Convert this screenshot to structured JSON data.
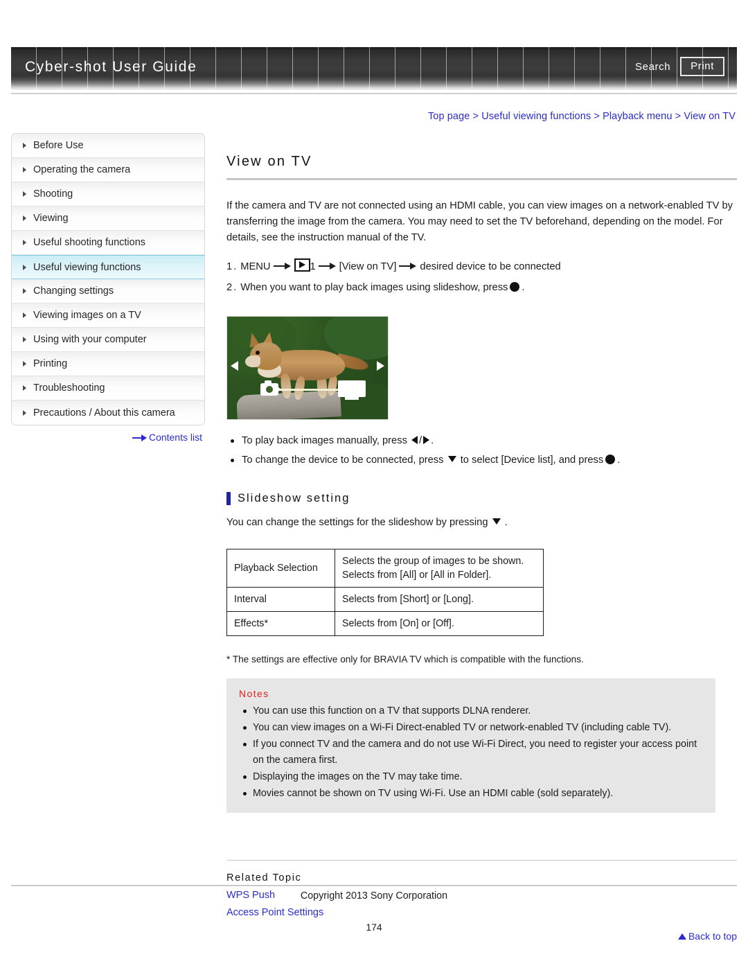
{
  "header": {
    "title": "Cyber-shot User Guide",
    "search_label": "Search",
    "print_label": "Print"
  },
  "breadcrumb": {
    "separator": ">",
    "items": [
      "Top page",
      "Useful viewing functions",
      "Playback menu",
      "View on TV"
    ]
  },
  "sidebar": {
    "items": [
      {
        "label": "Before Use",
        "active": false
      },
      {
        "label": "Operating the camera",
        "active": false
      },
      {
        "label": "Shooting",
        "active": false
      },
      {
        "label": "Viewing",
        "active": false
      },
      {
        "label": "Useful shooting functions",
        "active": false
      },
      {
        "label": "Useful viewing functions",
        "active": true
      },
      {
        "label": "Changing settings",
        "active": false
      },
      {
        "label": "Viewing images on a TV",
        "active": false
      },
      {
        "label": "Using with your computer",
        "active": false
      },
      {
        "label": "Printing",
        "active": false
      },
      {
        "label": "Troubleshooting",
        "active": false
      },
      {
        "label": "Precautions / About this camera",
        "active": false
      }
    ],
    "contents_list_label": "Contents list"
  },
  "main": {
    "page_title": "View on TV",
    "intro": "If the camera and TV are not connected using an HDMI cable, you can view images on a network-enabled TV by transferring the image from the camera. You may need to set the TV beforehand, depending on the model. For details, see the instruction manual of the TV.",
    "steps": [
      {
        "number": "1.",
        "part1": "MENU",
        "icon": "playback-mode-icon",
        "part2": "1",
        "part3": "[View on TV]",
        "part4": "desired device to be connected"
      },
      {
        "number": "2.",
        "text_before": "When you want to play back images using slideshow, press",
        "icon": "center-button-icon",
        "text_after": "."
      }
    ],
    "figure": {
      "caption": "camera-slideshow-screen",
      "overlay_icons": [
        "left-arrow",
        "right-arrow",
        "camera-icon",
        "tv-icon"
      ]
    },
    "bullets": [
      {
        "text_before": "To play back images manually, press",
        "icons": [
          "left-triangle-icon",
          "right-triangle-icon"
        ],
        "separator": "/",
        "text_after": "."
      },
      {
        "text_before": "To change the device to be connected, press",
        "icon1": "down-triangle-icon",
        "text_middle": "to select [Device list], and press",
        "icon2": "center-button-icon",
        "text_after": "."
      }
    ],
    "section": {
      "heading": "Slideshow setting",
      "description_before": "You can change the settings for the slideshow by pressing",
      "description_icon": "down-triangle-icon",
      "description_after": "."
    },
    "table": {
      "rows": [
        {
          "label": "Playback Selection",
          "description": "Selects the group of images to be shown. Selects from [All] or [All in Folder]."
        },
        {
          "label": "Interval",
          "description": "Selects from [Short] or [Long]."
        },
        {
          "label": "Effects*",
          "description": "Selects from [On] or [Off]."
        }
      ]
    },
    "footnote": "* The settings are effective only for BRAVIA TV which is compatible with the functions.",
    "notes": {
      "title": "Notes",
      "items": [
        "You can use this function on a TV that supports DLNA renderer.",
        "You can view images on a Wi-Fi Direct-enabled TV or network-enabled TV (including cable TV).",
        "If you connect TV and the camera and do not use Wi-Fi Direct, you need to register your access point on the camera first.",
        "Displaying the images on the TV may take time.",
        "Movies cannot be shown on TV using Wi-Fi. Use an HDMI cable (sold separately)."
      ]
    },
    "related": {
      "heading": "Related Topic",
      "links": [
        "WPS Push",
        "Access Point Settings"
      ]
    },
    "back_to_top_label": "Back to top"
  },
  "footer": {
    "copyright": "Copyright 2013 Sony Corporation",
    "page_number": "174"
  },
  "colors": {
    "link_blue": "#2b2bcf",
    "notes_red": "#e02020",
    "active_nav": "#c9edf6",
    "section_bar": "#2222a8"
  }
}
